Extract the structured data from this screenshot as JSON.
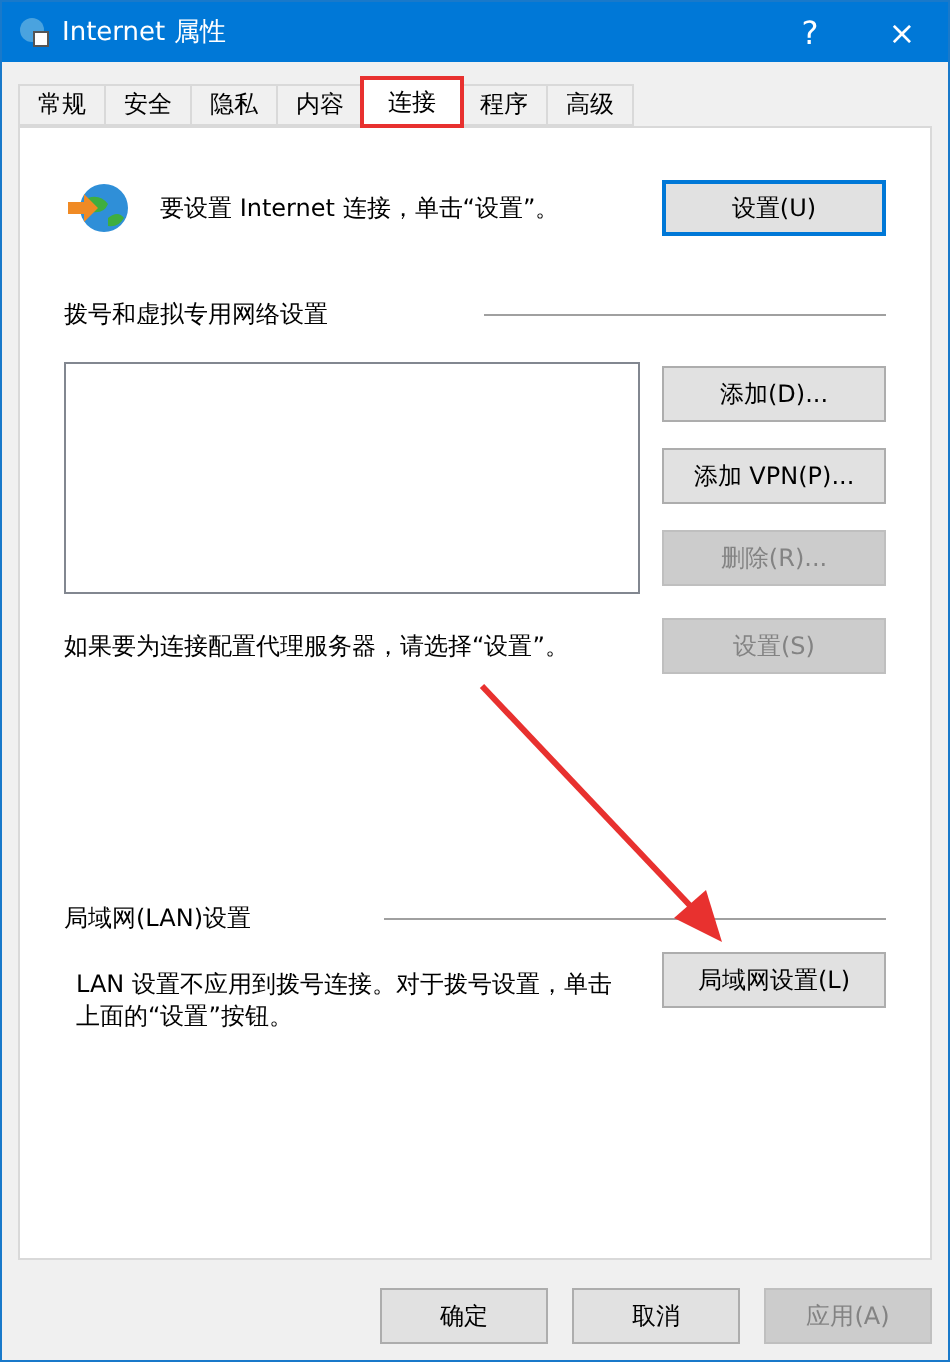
{
  "window": {
    "title": "Internet 属性",
    "help": "?",
    "close": "×"
  },
  "tabs": [
    {
      "label": "常规",
      "selected": false,
      "highlighted": false
    },
    {
      "label": "安全",
      "selected": false,
      "highlighted": false
    },
    {
      "label": "隐私",
      "selected": false,
      "highlighted": false
    },
    {
      "label": "内容",
      "selected": false,
      "highlighted": false
    },
    {
      "label": "连接",
      "selected": true,
      "highlighted": true
    },
    {
      "label": "程序",
      "selected": false,
      "highlighted": false
    },
    {
      "label": "高级",
      "selected": false,
      "highlighted": false
    }
  ],
  "setup": {
    "text": "要设置 Internet 连接，单击“设置”。",
    "button": "设置(U)"
  },
  "dialup": {
    "heading": "拨号和虚拟专用网络设置",
    "buttons": [
      {
        "label": "添加(D)...",
        "disabled": false
      },
      {
        "label": "添加 VPN(P)...",
        "disabled": false
      },
      {
        "label": "删除(R)...",
        "disabled": true
      }
    ],
    "proxy_text": "如果要为连接配置代理服务器，请选择“设置”。",
    "settings_button": {
      "label": "设置(S)",
      "disabled": true
    }
  },
  "lan": {
    "heading": "局域网(LAN)设置",
    "text": "LAN 设置不应用到拨号连接。对于拨号设置，单击上面的“设置”按钮。",
    "button": "局域网设置(L)"
  },
  "footer": [
    {
      "label": "确定",
      "disabled": false
    },
    {
      "label": "取消",
      "disabled": false
    },
    {
      "label": "应用(A)",
      "disabled": true
    }
  ]
}
